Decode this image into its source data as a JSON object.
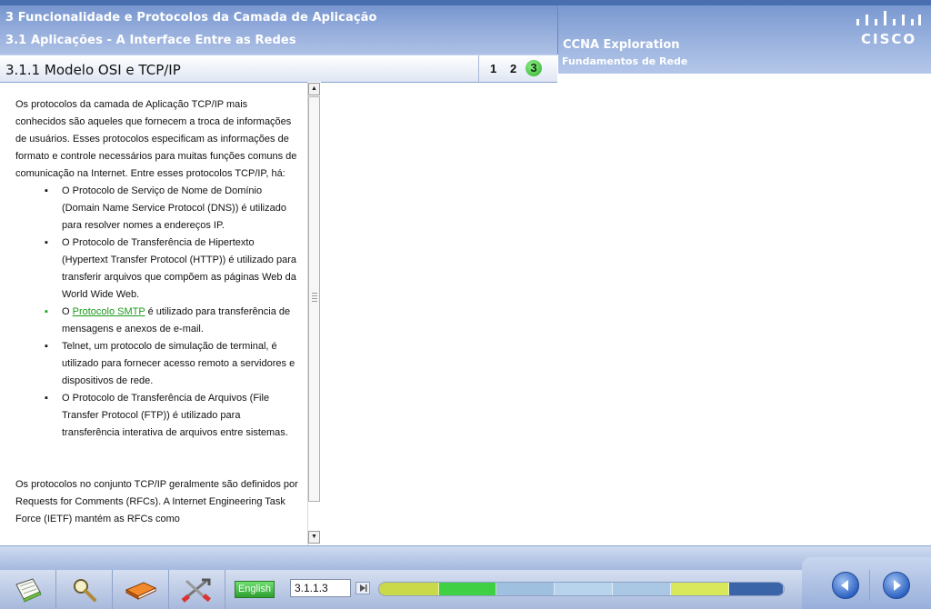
{
  "header": {
    "chapter": "3 Funcionalidade e Protocolos da Camada de Aplicação",
    "section": "3.1 Aplicações - A Interface Entre as Redes",
    "course": "CCNA Exploration",
    "course_sub": "Fundamentos de Rede",
    "logo_text": "CISCO"
  },
  "title_bar": {
    "page_title": "3.1.1 Modelo OSI e TCP/IP",
    "pages": [
      "1",
      "2",
      "3"
    ],
    "current_page": "3"
  },
  "content": {
    "intro": "Os protocolos da camada de Aplicação TCP/IP mais conhecidos são aqueles que fornecem a troca de informações de usuários. Esses protocolos especificam as informações de formato e controle necessários para muitas funções comuns de comunicação na Internet. Entre esses protocolos TCP/IP, há:",
    "bullet_symbol": "▪",
    "items": [
      {
        "text": "O Protocolo de Serviço de Nome de Domínio (Domain Name Service Protocol (DNS)) é utilizado para resolver nomes a endereços IP."
      },
      {
        "text": "O Protocolo de Transferência de Hipertexto (Hypertext Transfer Protocol (HTTP)) é utilizado para transferir arquivos que compõem as páginas Web da World Wide Web."
      },
      {
        "prefix": "O ",
        "link": "Protocolo SMTP",
        "suffix": " é utilizado para transferência de mensagens e anexos de e-mail."
      },
      {
        "text": "Telnet, um protocolo de simulação de terminal, é utilizado para fornecer acesso remoto a servidores e dispositivos de rede."
      },
      {
        "text": "O Protocolo de Transferência de Arquivos (File Transfer Protocol (FTP)) é utilizado para transferência interativa de arquivos entre sistemas."
      }
    ],
    "outro": "Os protocolos no conjunto TCP/IP geralmente são definidos por Requests for Comments (RFCs). A Internet Engineering Task Force (IETF) mantém as RFCs como"
  },
  "toolbar": {
    "language_label": "English",
    "page_value": "3.1.1.3",
    "progress_colors": [
      "#c9d94a",
      "#3fd043",
      "#9fc0de",
      "#b8d4ec",
      "#aac8e4",
      "#d8e85a",
      "#3a64a8"
    ]
  },
  "icons": {
    "glossary": "notepad-icon",
    "search": "magnifier-icon",
    "book": "book-icon",
    "tools": "tools-icon",
    "prev": "back-arrow-icon",
    "next": "forward-arrow-icon"
  }
}
